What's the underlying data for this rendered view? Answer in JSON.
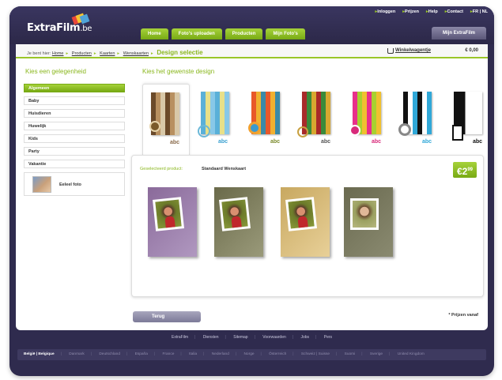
{
  "brand": {
    "logo_text": "ExtraFilm",
    "logo_suffix": ".be"
  },
  "top_links": [
    "Inloggen",
    "Prijzen",
    "Help",
    "Contact",
    "FR | NL"
  ],
  "nav_tabs": [
    "Home",
    "Foto's uploaden",
    "Producten",
    "Mijn Foto's"
  ],
  "mijn_extrafilm": "Mijn ExtraFilm",
  "breadcrumb": {
    "prefix": "Je bent hier:",
    "items": [
      "Home",
      "Producten",
      "Kaarten",
      "Wenskaarten"
    ],
    "current": "Design selectie"
  },
  "cart": {
    "label": "Winkelwagentje",
    "price": "€ 0,00"
  },
  "sidebar": {
    "heading": "Kies een gelegenheid",
    "occasions": [
      "Algemeen",
      "Baby",
      "Huisdieren",
      "Huwelijk",
      "Kids",
      "Party",
      "Vakantie"
    ],
    "selected_index": 0,
    "own_photo_label": "Eeleel foto"
  },
  "main": {
    "heading": "Kies het gewenste design",
    "design_caption": "abc",
    "product_label": "Geselecteerd product:",
    "product_name": "Standaard Wenskaart",
    "price_main": "2",
    "price_cents": "99",
    "back_button": "Terug",
    "prices_note": "* Prijzen vanaf"
  },
  "footer": {
    "links": [
      "ExtraFilm",
      "Diensten",
      "Sitemap",
      "Voorwaarden",
      "Jobs",
      "Pers"
    ],
    "countries": [
      "België | Belgique",
      "Danmark",
      "Deutschland",
      "España",
      "France",
      "Italia",
      "Nederland",
      "Norge",
      "Österreich",
      "Schweiz | Suisse",
      "Suomi",
      "Sverige",
      "United Kingdom"
    ]
  },
  "colors": {
    "accent_green": "#8ab71e",
    "frame_dark": "#2f2b4e"
  }
}
